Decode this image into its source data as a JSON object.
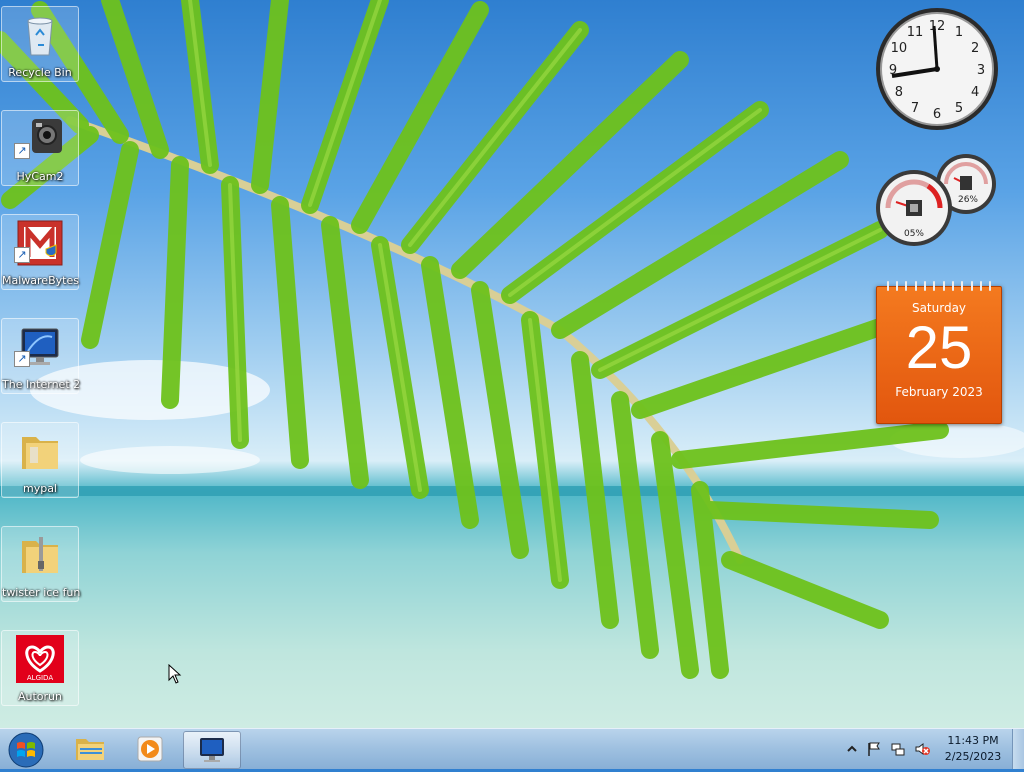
{
  "desktop": {
    "icons": [
      {
        "label": "Recycle Bin",
        "icon": "recycle-bin-icon"
      },
      {
        "label": "HyCam2",
        "icon": "camera-icon"
      },
      {
        "label": "MalwareBytes",
        "icon": "malwarebytes-icon"
      },
      {
        "label": "The Internet 2",
        "icon": "monitor-icon"
      },
      {
        "label": "mypal",
        "icon": "folder-icon"
      },
      {
        "label": "twister ice fun",
        "icon": "zip-folder-icon"
      },
      {
        "label": "Autorun",
        "icon": "algida-icon",
        "logo_text": "ALGIDA"
      }
    ]
  },
  "gadgets": {
    "clock": {
      "numbers": [
        "12",
        "1",
        "2",
        "3",
        "4",
        "5",
        "6",
        "7",
        "8",
        "9",
        "10",
        "11"
      ]
    },
    "meter": {
      "cpu_label": "05%",
      "memory_label": "26%",
      "cpu": 0.05,
      "memory": 0.26
    },
    "calendar": {
      "weekday": "Saturday",
      "day": "25",
      "month_year": "February 2023"
    }
  },
  "taskbar": {
    "start_icon": "windows-start-icon",
    "pinned": [
      "explorer-icon",
      "media-player-icon",
      "monitor-icon"
    ],
    "time": "11:43 PM",
    "date": "2/25/2023",
    "tray_icons": [
      "chevron-up-icon",
      "flag-icon",
      "network-icon",
      "volume-muted-icon"
    ]
  },
  "colors": {
    "calendar": "#e8620f",
    "taskbar": "#9ec0e0"
  }
}
